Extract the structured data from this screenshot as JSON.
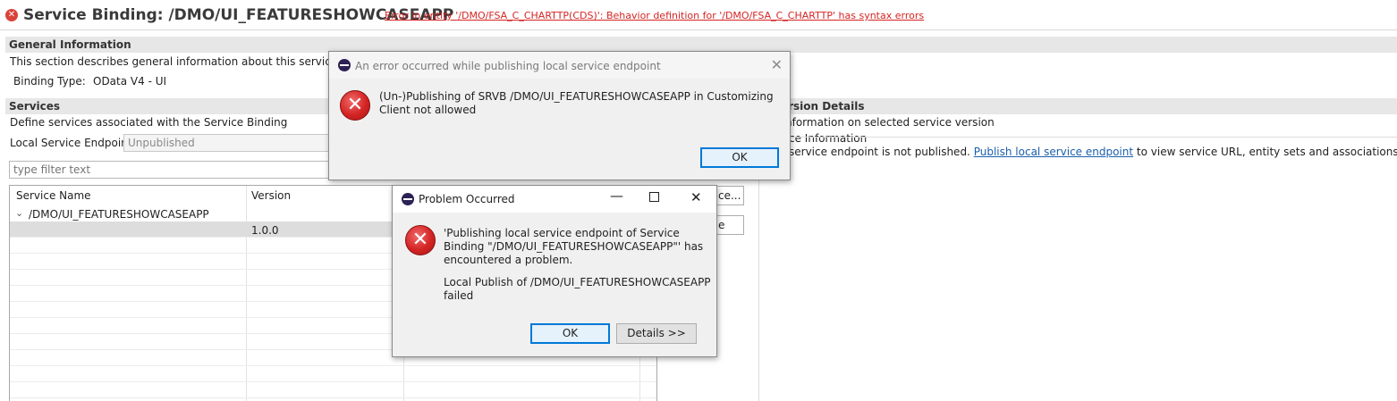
{
  "header": {
    "title": "Service Binding: /DMO/UI_FEATURESHOWCASEAPP",
    "error_link": "Error in entity '/DMO/FSA_C_CHARTTP(CDS)': Behavior definition for '/DMO/FSA_C_CHARTTP' has syntax errors"
  },
  "general": {
    "heading": "General Information",
    "description": "This section describes general information about this service binding",
    "binding_type_label": "Binding Type:",
    "binding_type_value": "OData V4 - UI"
  },
  "services": {
    "heading": "Services",
    "description": "Define services associated with the Service Binding",
    "endpoint_label": "Local Service Endpoint:",
    "endpoint_value": "Unpublished",
    "filter_placeholder": "type filter text",
    "columns": [
      "Service Name",
      "Version"
    ],
    "tree_node": "/DMO/UI_FEATURESHOWCASEAPP",
    "row_version": "1.0.0",
    "side_button_1_partial": "ce...",
    "side_button_2_partial": "e"
  },
  "version_details": {
    "heading_partial": "e Version Details",
    "subtitle_partial": "nformation on selected service version",
    "service_info_partial": "ce Information",
    "endpoint_msg_prefix": "service endpoint is not published.",
    "publish_link": "Publish local service endpoint",
    "endpoint_msg_suffix": "to view service URL, entity sets and associations."
  },
  "dialog_publish_error": {
    "title": "An error occurred while publishing local service endpoint",
    "message": "(Un-)Publishing of SRVB /DMO/UI_FEATURESHOWCASEAPP in Customizing Client not allowed",
    "ok_label": "OK"
  },
  "dialog_problem": {
    "title": "Problem Occurred",
    "message": "'Publishing local service endpoint of Service Binding \"/DMO/UI_FEATURESHOWCASEAPP\"' has encountered a problem.",
    "detail": "Local Publish of /DMO/UI_FEATURESHOWCASEAPP failed",
    "ok_label": "OK",
    "details_label": "Details >>"
  },
  "icons": {
    "error": "error-icon",
    "eclipse": "eclipse-icon",
    "close": "close-icon",
    "minimize": "minimize-icon",
    "maximize": "maximize-icon",
    "chevron": "chevron-down-icon"
  },
  "colors": {
    "error_red": "#d62424",
    "link_blue": "#1b5fad",
    "section_bg": "#e7e7e7",
    "default_button_border": "#0078d7"
  }
}
